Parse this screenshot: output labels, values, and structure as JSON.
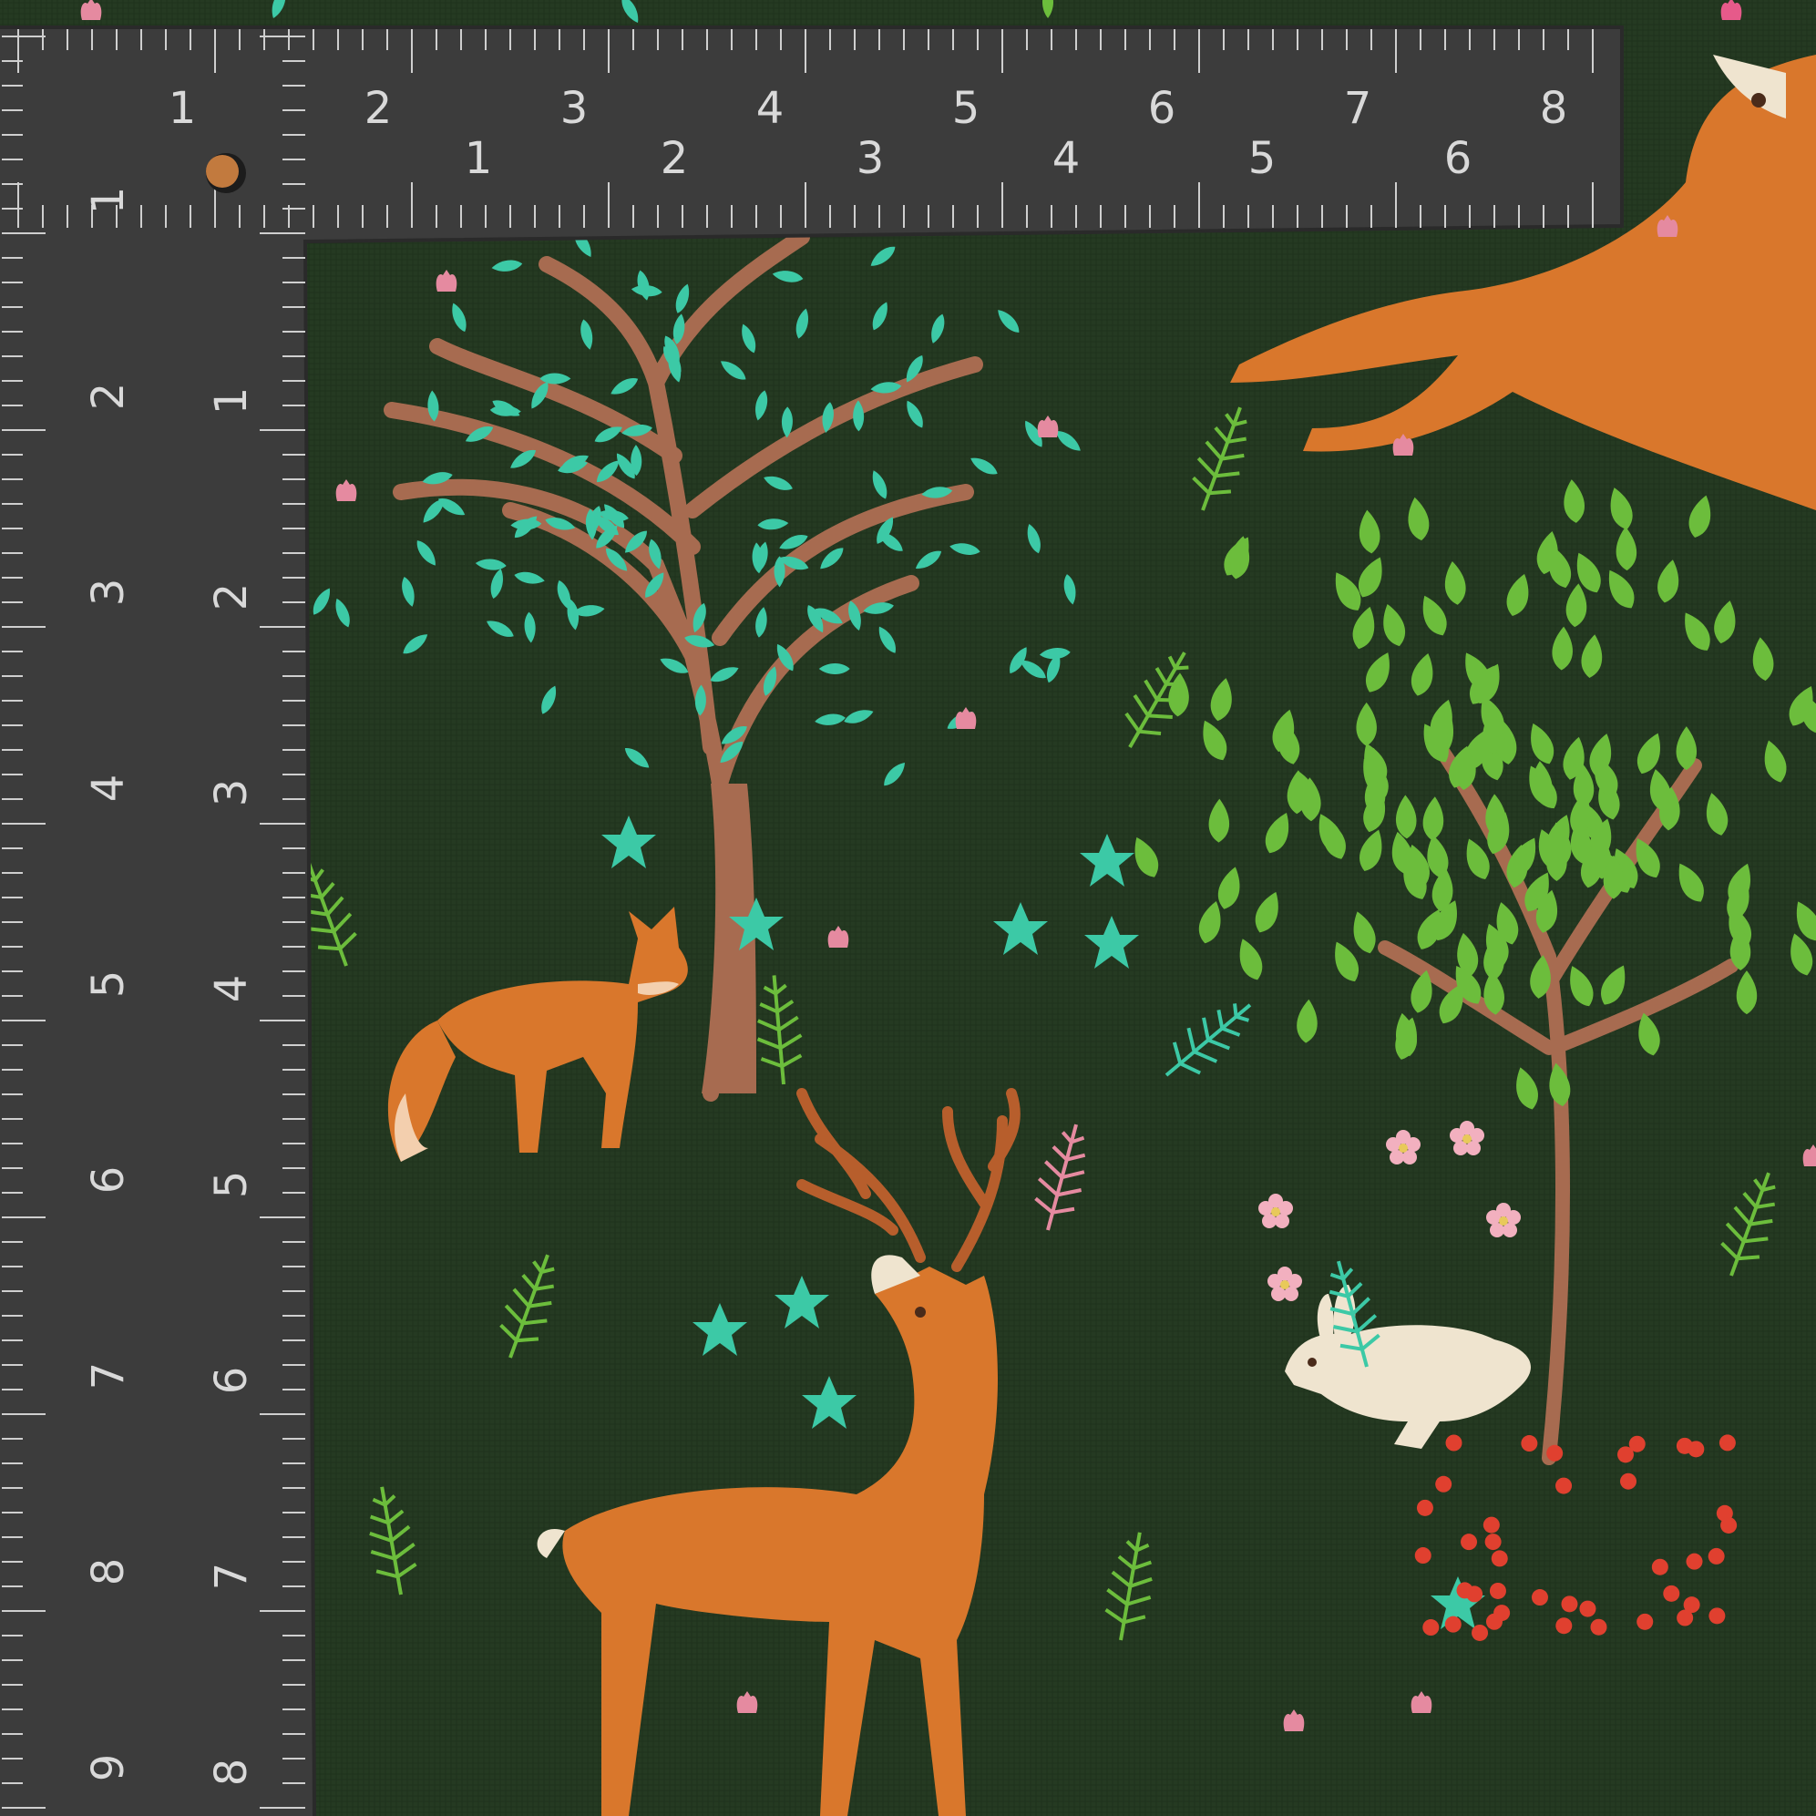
{
  "image": {
    "subject": "woodland-print-fabric-with-measuring-square",
    "colors": {
      "fabric_background": "#253a22",
      "ruler_body": "#3c3c3c",
      "ruler_text": "#d9d9d9",
      "teal_leaf": "#3cc9a6",
      "green_leaf": "#6cbd3c",
      "orange_animal": "#d9772c",
      "trunk": "#a76b50",
      "pink_flower": "#e58aa0",
      "red_berry": "#e0402f",
      "cream_rabbit": "#efe4cf"
    }
  },
  "ruler": {
    "top_outer_numbers": [
      "1",
      "2",
      "3",
      "4",
      "5",
      "6",
      "7",
      "8"
    ],
    "top_inner_numbers": [
      "1",
      "2",
      "3",
      "4",
      "5",
      "6"
    ],
    "left_outer_numbers": [
      "1",
      "2",
      "3",
      "4",
      "5",
      "6",
      "7",
      "8",
      "9"
    ],
    "left_inner_numbers": [
      "1",
      "2",
      "3",
      "4",
      "5",
      "6",
      "7",
      "8"
    ]
  },
  "pattern": {
    "animals": [
      "fox-icon",
      "stag-icon",
      "rabbit-icon",
      "leaping-deer-icon"
    ],
    "plants": [
      "teal-leaf-tree",
      "green-leaf-tree",
      "fern",
      "flower",
      "berry-sprig"
    ]
  }
}
